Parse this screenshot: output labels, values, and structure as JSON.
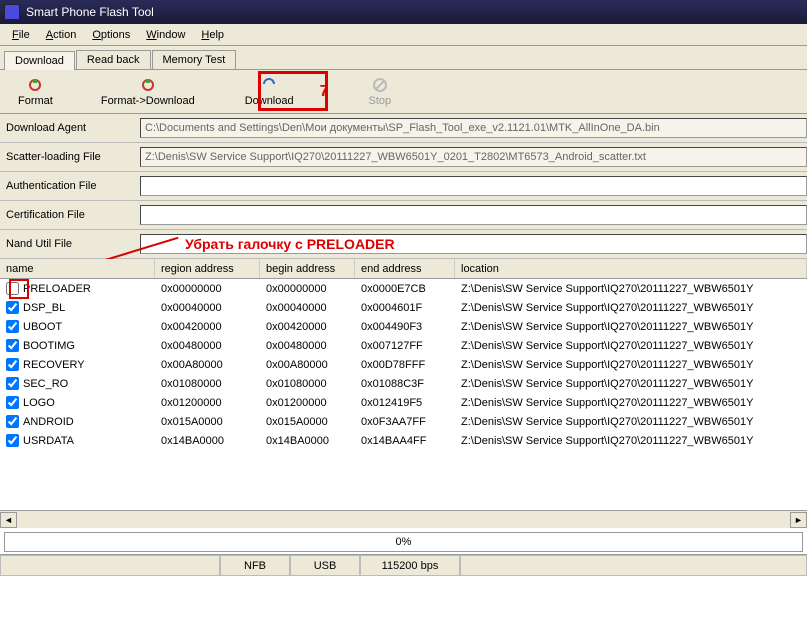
{
  "window": {
    "title": "Smart Phone Flash Tool"
  },
  "menu": {
    "file": "File",
    "action": "Action",
    "options": "Options",
    "window": "Window",
    "help": "Help"
  },
  "tabs": {
    "download": "Download",
    "readback": "Read back",
    "memtest": "Memory Test"
  },
  "toolbar": {
    "format": "Format",
    "format_dl": "Format->Download",
    "download": "Download",
    "stop": "Stop"
  },
  "annotation": {
    "seven": "7",
    "preloader_note": "Убрать галочку с PRELOADER"
  },
  "files": {
    "da_label": "Download Agent",
    "da_value": "C:\\Documents and Settings\\Den\\Мои документы\\SP_Flash_Tool_exe_v2.1121.01\\MTK_AllInOne_DA.bin",
    "scatter_label": "Scatter-loading File",
    "scatter_value": "Z:\\Denis\\SW Service Support\\IQ270\\20111227_WBW6501Y_0201_T2802\\MT6573_Android_scatter.txt",
    "auth_label": "Authentication File",
    "auth_value": "",
    "cert_label": "Certification File",
    "cert_value": "",
    "nand_label": "Nand Util File",
    "nand_value": ""
  },
  "table": {
    "headers": {
      "name": "name",
      "region": "region address",
      "begin": "begin address",
      "end": "end address",
      "location": "location"
    },
    "rows": [
      {
        "checked": false,
        "name": "PRELOADER",
        "region": "0x00000000",
        "begin": "0x00000000",
        "end": "0x0000E7CB",
        "location": "Z:\\Denis\\SW Service Support\\IQ270\\20111227_WBW6501Y"
      },
      {
        "checked": true,
        "name": "DSP_BL",
        "region": "0x00040000",
        "begin": "0x00040000",
        "end": "0x0004601F",
        "location": "Z:\\Denis\\SW Service Support\\IQ270\\20111227_WBW6501Y"
      },
      {
        "checked": true,
        "name": "UBOOT",
        "region": "0x00420000",
        "begin": "0x00420000",
        "end": "0x004490F3",
        "location": "Z:\\Denis\\SW Service Support\\IQ270\\20111227_WBW6501Y"
      },
      {
        "checked": true,
        "name": "BOOTIMG",
        "region": "0x00480000",
        "begin": "0x00480000",
        "end": "0x007127FF",
        "location": "Z:\\Denis\\SW Service Support\\IQ270\\20111227_WBW6501Y"
      },
      {
        "checked": true,
        "name": "RECOVERY",
        "region": "0x00A80000",
        "begin": "0x00A80000",
        "end": "0x00D78FFF",
        "location": "Z:\\Denis\\SW Service Support\\IQ270\\20111227_WBW6501Y"
      },
      {
        "checked": true,
        "name": "SEC_RO",
        "region": "0x01080000",
        "begin": "0x01080000",
        "end": "0x01088C3F",
        "location": "Z:\\Denis\\SW Service Support\\IQ270\\20111227_WBW6501Y"
      },
      {
        "checked": true,
        "name": "LOGO",
        "region": "0x01200000",
        "begin": "0x01200000",
        "end": "0x012419F5",
        "location": "Z:\\Denis\\SW Service Support\\IQ270\\20111227_WBW6501Y"
      },
      {
        "checked": true,
        "name": "ANDROID",
        "region": "0x015A0000",
        "begin": "0x015A0000",
        "end": "0x0F3AA7FF",
        "location": "Z:\\Denis\\SW Service Support\\IQ270\\20111227_WBW6501Y"
      },
      {
        "checked": true,
        "name": "USRDATA",
        "region": "0x14BA0000",
        "begin": "0x14BA0000",
        "end": "0x14BAA4FF",
        "location": "Z:\\Denis\\SW Service Support\\IQ270\\20111227_WBW6501Y"
      }
    ]
  },
  "progress": {
    "percent": "0%"
  },
  "status": {
    "nfb": "NFB",
    "usb": "USB",
    "baud": "115200 bps"
  }
}
